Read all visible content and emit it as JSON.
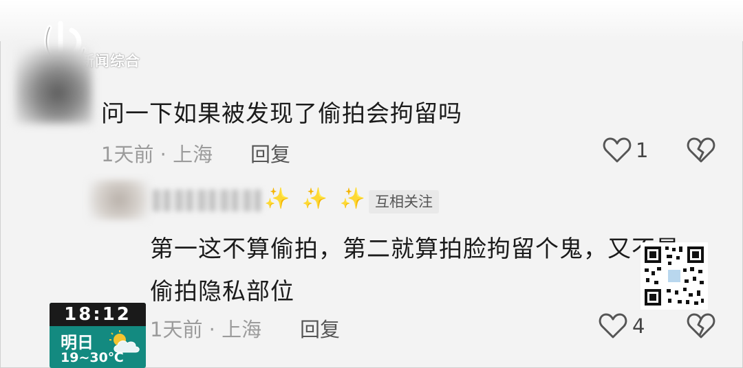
{
  "watermark": {
    "logo_text": "新闻综合"
  },
  "comments": [
    {
      "text": "问一下如果被发现了偷拍会拘留吗",
      "meta": "1天前 · 上海",
      "reply_label": "回复",
      "likes": "1"
    },
    {
      "author_decoration": "✨ ✨ ✨",
      "badge": "互相关注",
      "text_line1": "第一这不算偷拍，第二就算拍脸拘留个鬼，又不是",
      "text_line2": "偷拍隐私部位",
      "meta": "1天前 · 上海",
      "reply_label": "回复",
      "likes": "4"
    }
  ],
  "icons": {
    "like": "heart-outline-icon",
    "dislike": "broken-heart-icon",
    "qr": "qr-code-icon",
    "weather": "partly-cloudy-icon"
  },
  "widget": {
    "time": "18:12",
    "day": "明日",
    "temperature": "19~30℃"
  },
  "colors": {
    "widget_bg": "#138a80",
    "sparkle": "#f2c51e",
    "meta_gray": "#9b9b9b"
  }
}
